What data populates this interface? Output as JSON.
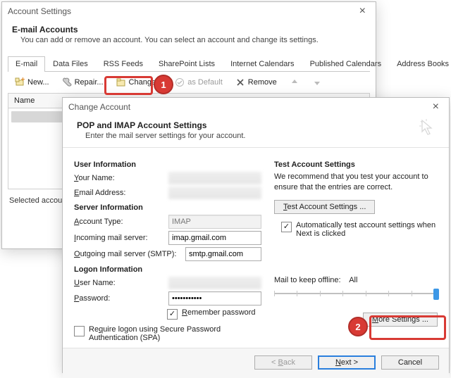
{
  "parent": {
    "title": "Account Settings",
    "header": "E-mail Accounts",
    "subheader": "You can add or remove an account. You can select an account and change its settings.",
    "tabs": [
      "E-mail",
      "Data Files",
      "RSS Feeds",
      "SharePoint Lists",
      "Internet Calendars",
      "Published Calendars",
      "Address Books"
    ],
    "toolbar": {
      "new": "New...",
      "repair": "Repair...",
      "change": "Change...",
      "set_default": "as Default",
      "remove": "Remove"
    },
    "list_header": "Name",
    "truncated": "Selected account de"
  },
  "badges": {
    "one": "1",
    "two": "2"
  },
  "dialog": {
    "title": "Change Account",
    "header": "POP and IMAP Account Settings",
    "subheader": "Enter the mail server settings for your account.",
    "groups": {
      "user": "User Information",
      "server": "Server Information",
      "logon": "Logon Information",
      "test": "Test Account Settings"
    },
    "labels": {
      "your_name": "Your Name:",
      "email": "Email Address:",
      "account_type": "Account Type:",
      "incoming": "Incoming mail server:",
      "outgoing": "Outgoing mail server (SMTP):",
      "username": "User Name:",
      "password": "Password:",
      "remember": "Remember password",
      "spa": "Require logon using Secure Password Authentication (SPA)",
      "test_desc": "We recommend that you test your account to ensure that the entries are correct.",
      "auto_test": "Automatically test account settings when Next is clicked",
      "mail_offline": "Mail to keep offline:",
      "mail_offline_value": "All"
    },
    "values": {
      "account_type": "IMAP",
      "incoming": "imap.gmail.com",
      "outgoing": "smtp.gmail.com",
      "password": "•••••••••••"
    },
    "buttons": {
      "test": "Test Account Settings ...",
      "more": "More Settings ...",
      "back": "< Back",
      "next": "Next >",
      "cancel": "Cancel"
    }
  }
}
